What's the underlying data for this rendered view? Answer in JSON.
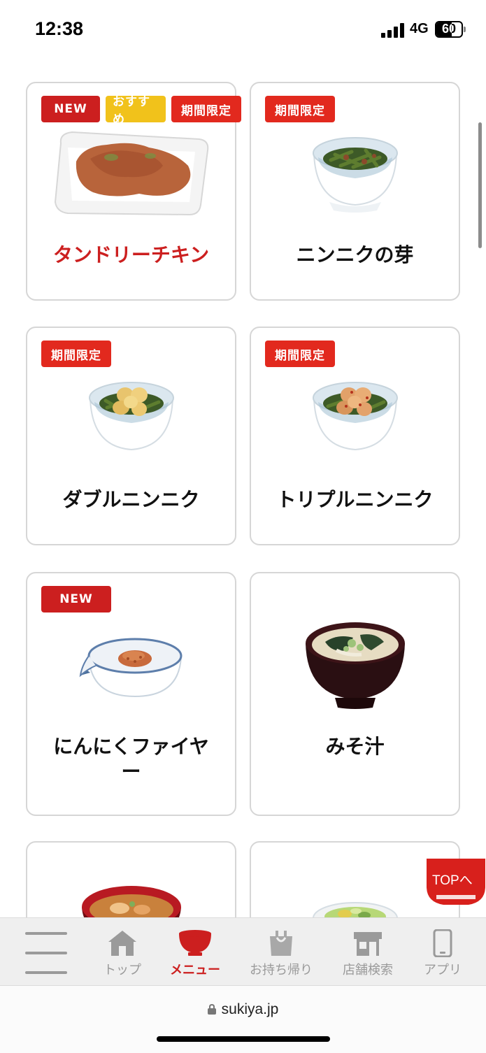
{
  "status_bar": {
    "time": "12:38",
    "network": "4G",
    "battery": "60"
  },
  "cards": [
    {
      "name": "タンドリーチキン",
      "badges": [
        "NEW",
        "おすすめ",
        "期間限定"
      ]
    },
    {
      "name": "ニンニクの芽",
      "badges": [
        "期間限定"
      ]
    },
    {
      "name": "ダブルニンニク",
      "badges": [
        "期間限定"
      ]
    },
    {
      "name": "トリプルニンニク",
      "badges": [
        "期間限定"
      ]
    },
    {
      "name_line1": "にんにくファイヤ",
      "name_line2": "ー",
      "badges": [
        "NEW"
      ]
    },
    {
      "name": "みそ汁",
      "badges": []
    }
  ],
  "top_button": {
    "label": "TOPへ"
  },
  "bottom_nav": {
    "items": [
      {
        "label": "トップ",
        "icon": "home-icon"
      },
      {
        "label": "メニュー",
        "icon": "bowl-icon"
      },
      {
        "label": "お持ち帰り",
        "icon": "bag-icon"
      },
      {
        "label": "店舗検索",
        "icon": "store-icon"
      },
      {
        "label": "アプリ",
        "icon": "phone-icon"
      }
    ]
  },
  "browser": {
    "url": "sukiya.jp"
  },
  "colors": {
    "accent": "#cc1f1f",
    "badge_red": "#e2291e",
    "badge_yellow": "#f1c21b",
    "nav_gray": "#9a9a9a"
  }
}
